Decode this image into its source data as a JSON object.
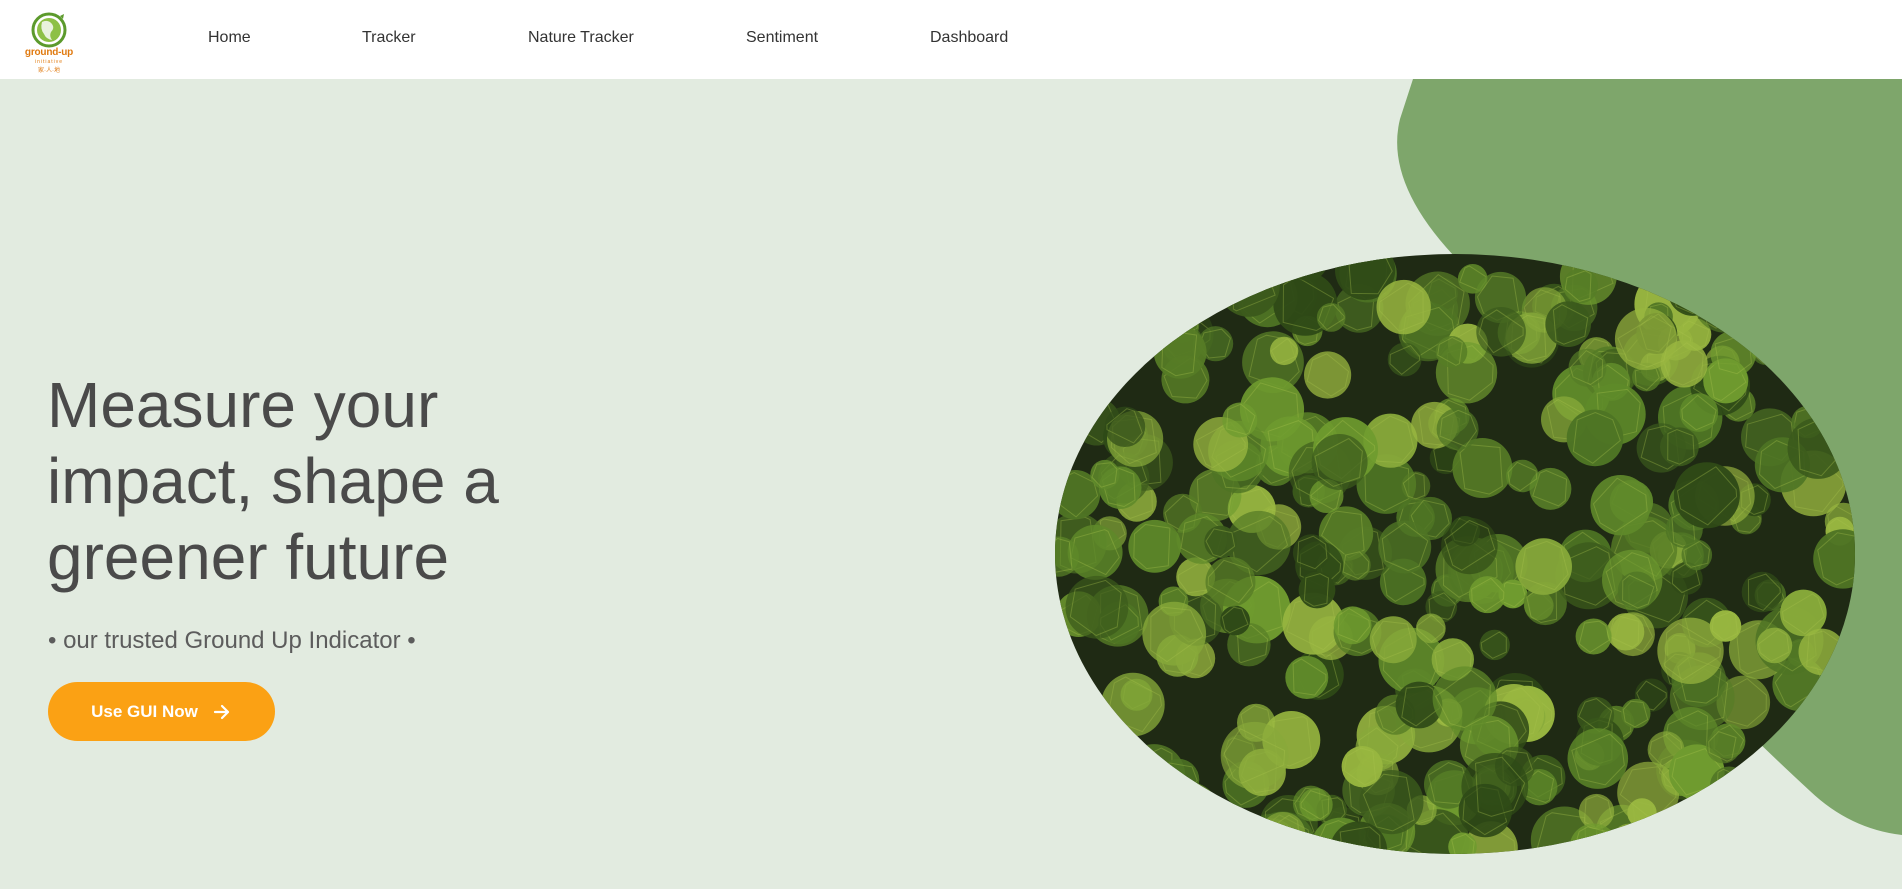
{
  "brand": {
    "logo_word": "ground-up",
    "logo_sub": "initiative",
    "logo_cjk": "家·人·地"
  },
  "nav": {
    "items": [
      {
        "label": "Home"
      },
      {
        "label": "Tracker"
      },
      {
        "label": "Nature Tracker"
      },
      {
        "label": "Sentiment"
      },
      {
        "label": "Dashboard"
      }
    ]
  },
  "hero": {
    "headline_lines": [
      "Measure your",
      "impact, shape a",
      "greener future"
    ],
    "tagline": "• our trusted Ground Up Indicator •",
    "cta_label": "Use GUI Now",
    "cta_icon": "arrow-right-icon",
    "image_subject": "aerial-forest-image"
  },
  "colors": {
    "hero_bg": "#e2ebe0",
    "blob": "#7ea66b",
    "cta": "#fba114",
    "text": "#4a4a4a",
    "logo_orange": "#e07a10",
    "logo_green": "#5c9a2c"
  }
}
